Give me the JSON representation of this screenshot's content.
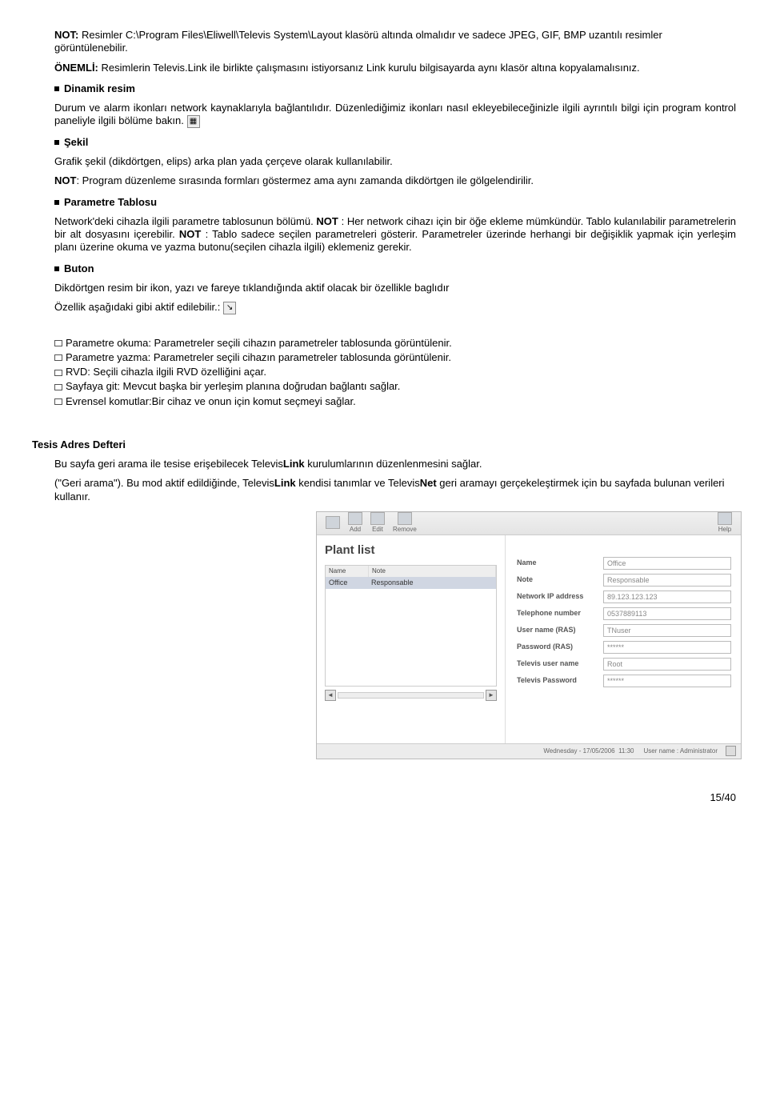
{
  "note1_prefix": "NOT:",
  "note1_body": " Resimler C:\\Program Files\\Eliwell\\Televis System\\Layout klasörü altında olmalıdır ve sadece JPEG, GIF, BMP uzantılı resimler görüntülenebilir.",
  "important_prefix": "ÖNEMLİ:",
  "important_body": " Resimlerin Televis.Link ile birlikte çalışmasını istiyorsanız Link kurulu bilgisayarda aynı klasör altına kopyalamalısınız.",
  "h_dinamik": "Dinamik resim",
  "p_dinamik_1": "Durum ve alarm ikonları network kaynaklarıyla bağlantılıdır. Düzenlediğimiz ikonları nasıl ekleyebileceğinizle ilgili ayrıntılı bilgi için program kontrol paneliyle ilgili bölüme bakın.",
  "h_sekil": "Şekil",
  "p_sekil_1": "Grafik şekil (dikdörtgen, elips) arka plan yada çerçeve olarak kullanılabilir.",
  "p_sekil_2a": "NOT",
  "p_sekil_2b": ": Program düzenleme sırasında formları göstermez ama aynı zamanda dikdörtgen ile gölgelendirilir.",
  "h_param": "Parametre Tablosu",
  "p_param_a": "Network'deki cihazla ilgili parametre tablosunun bölümü. ",
  "p_param_b": "NOT",
  "p_param_c": ": Her network cihazı için bir öğe ekleme mümkündür. Tablo kulanılabilir parametrelerin bir alt dosyasını içerebilir. ",
  "p_param_d": "NOT",
  "p_param_e": ": Tablo sadece seçilen parametreleri gösterir. Parametreler üzerinde herhangi bir değişiklik yapmak için yerleşim planı üzerine okuma ve yazma butonu(seçilen cihazla ilgili) eklemeniz gerekir.",
  "h_buton": "Buton",
  "p_buton_1": "Dikdörtgen resim bir ikon, yazı ve fareye tıklandığında aktif olacak bir özellikle baglıdır",
  "p_buton_2": "Özellik aşağıdaki gibi aktif edilebilir.:",
  "li1": "Parametre okuma: Parametreler seçili cihazın parametreler tablosunda görüntülenir.",
  "li2": "Parametre yazma: Parametreler seçili cihazın parametreler tablosunda görüntülenir.",
  "li3": "RVD: Seçili cihazla ilgili RVD özelliğini açar.",
  "li4": "Sayfaya git: Mevcut başka bir yerleşim planına doğrudan bağlantı sağlar.",
  "li5": "Evrensel komutlar:Bir cihaz ve onun için komut seçmeyi sağlar.",
  "h_tesis": "Tesis Adres Defteri",
  "p_tesis_1a": "Bu sayfa geri arama  ile tesise erişebilecek Televis",
  "p_tesis_1b": "Link",
  "p_tesis_1c": " kurulumlarının düzenlenmesini sağlar.",
  "p_tesis_2a": "(\"Geri arama\"). Bu mod aktif edildiğinde, Televis",
  "p_tesis_2b": "Link",
  "p_tesis_2c": " kendisi tanımlar ve Televis",
  "p_tesis_2d": "Net",
  "p_tesis_2e": " geri aramayı gerçekeleştirmek için bu sayfada bulunan verileri kullanır.",
  "toolbar": {
    "add": "Add",
    "edit": "Edit",
    "remove": "Remove",
    "help": "Help",
    "blank": ""
  },
  "shot": {
    "title": "Plant list",
    "col1": "Name",
    "col2": "Note",
    "row_name": "Office",
    "row_note": "Responsable",
    "f1": "Name",
    "v1": "Office",
    "f2": "Note",
    "v2": "Responsable",
    "f3": "Network IP address",
    "v3": "89.123.123.123",
    "f4": "Telephone number",
    "v4": "0537889113",
    "f5": "User name (RAS)",
    "v5": "TNuser",
    "f6": "Password (RAS)",
    "v6": "******",
    "f7": "Televis user name",
    "v7": "Root",
    "f8": "Televis Password",
    "v8": "******"
  },
  "status": {
    "date": "Wednesday - 17/05/2006",
    "time": "11:30",
    "user": "User name : Administrator"
  },
  "page": "15/40"
}
